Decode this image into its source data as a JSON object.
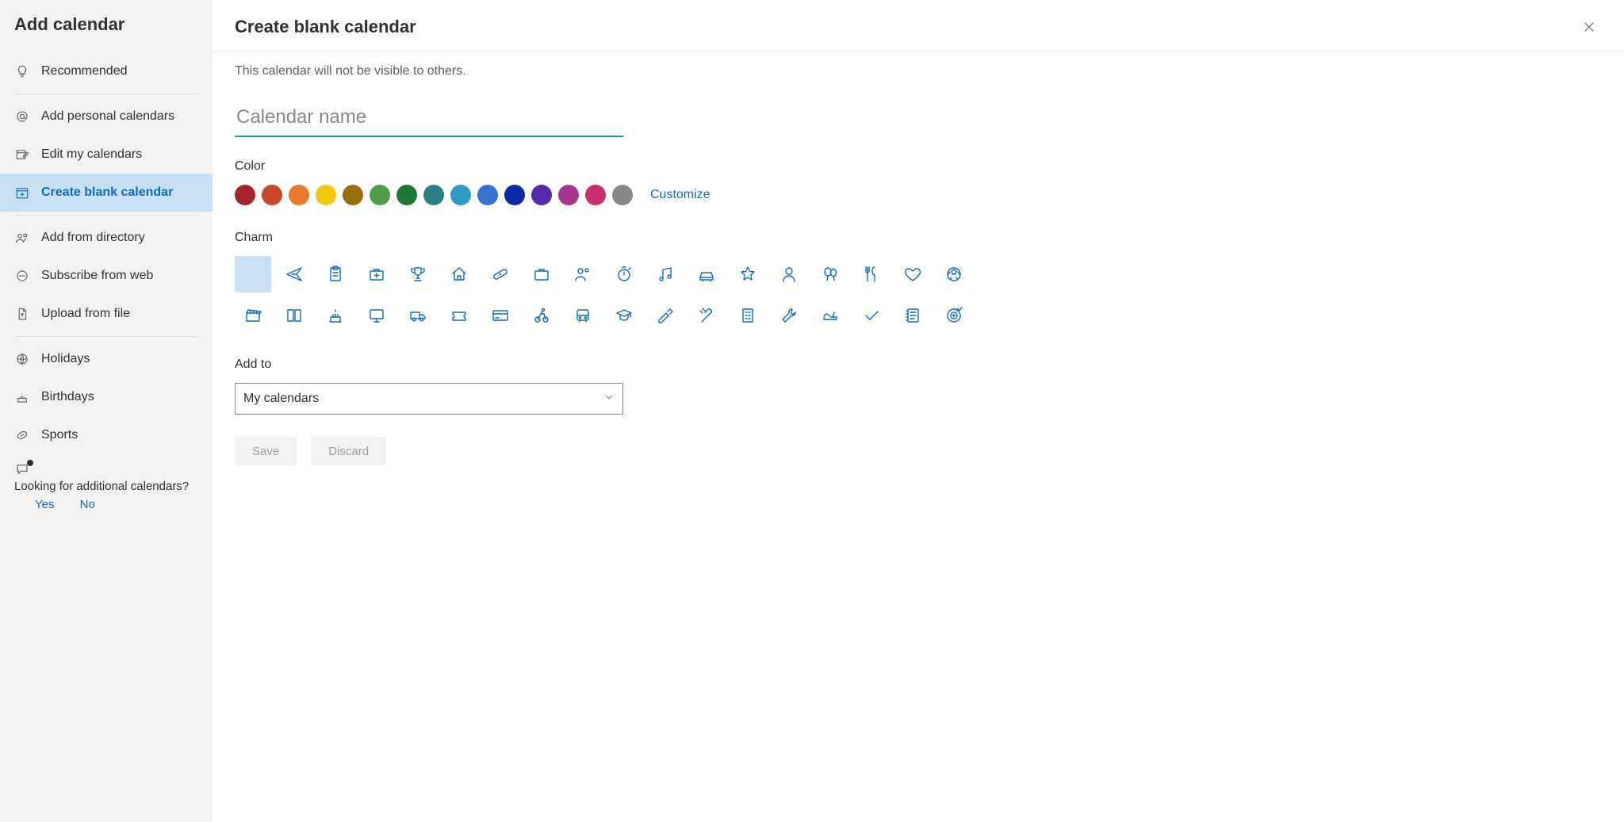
{
  "sidebar": {
    "title": "Add calendar",
    "items": [
      {
        "id": "recommended",
        "label": "Recommended"
      },
      {
        "id": "add-personal",
        "label": "Add personal calendars"
      },
      {
        "id": "edit-my",
        "label": "Edit my calendars"
      },
      {
        "id": "create-blank",
        "label": "Create blank calendar",
        "active": true
      },
      {
        "id": "add-directory",
        "label": "Add from directory"
      },
      {
        "id": "subscribe-web",
        "label": "Subscribe from web"
      },
      {
        "id": "upload-file",
        "label": "Upload from file"
      },
      {
        "id": "holidays",
        "label": "Holidays"
      },
      {
        "id": "birthdays",
        "label": "Birthdays"
      },
      {
        "id": "sports",
        "label": "Sports"
      }
    ],
    "feedback": {
      "prompt": "Looking for additional calendars?",
      "yes": "Yes",
      "no": "No"
    }
  },
  "main": {
    "title": "Create blank calendar",
    "subtext": "This calendar will not be visible to others.",
    "name_placeholder": "Calendar name",
    "color_label": "Color",
    "colors": [
      "#a4262c",
      "#c8472c",
      "#e8792b",
      "#f2c811",
      "#986f0b",
      "#4f9d4b",
      "#1f7836",
      "#2c8282",
      "#2f9ac4",
      "#3971d1",
      "#0b2ba5",
      "#562aae",
      "#a4368f",
      "#c92d6e",
      "#888686"
    ],
    "customize": "Customize",
    "charm_label": "Charm",
    "charms": [
      "none",
      "airplane",
      "clipboard",
      "briefcase-medical",
      "trophy",
      "home",
      "bandage",
      "briefcase",
      "people",
      "stopwatch",
      "music",
      "car",
      "star",
      "person",
      "balloons",
      "food",
      "heart",
      "soccer",
      "clapper",
      "book",
      "cake",
      "monitor",
      "truck",
      "ticket",
      "credit-card",
      "cycling",
      "bus",
      "graduation",
      "paint",
      "tools",
      "building",
      "wrench",
      "shoe",
      "checkmark",
      "notes",
      "target"
    ],
    "charm_selected": "none",
    "addto_label": "Add to",
    "addto_value": "My calendars",
    "save": "Save",
    "discard": "Discard"
  }
}
